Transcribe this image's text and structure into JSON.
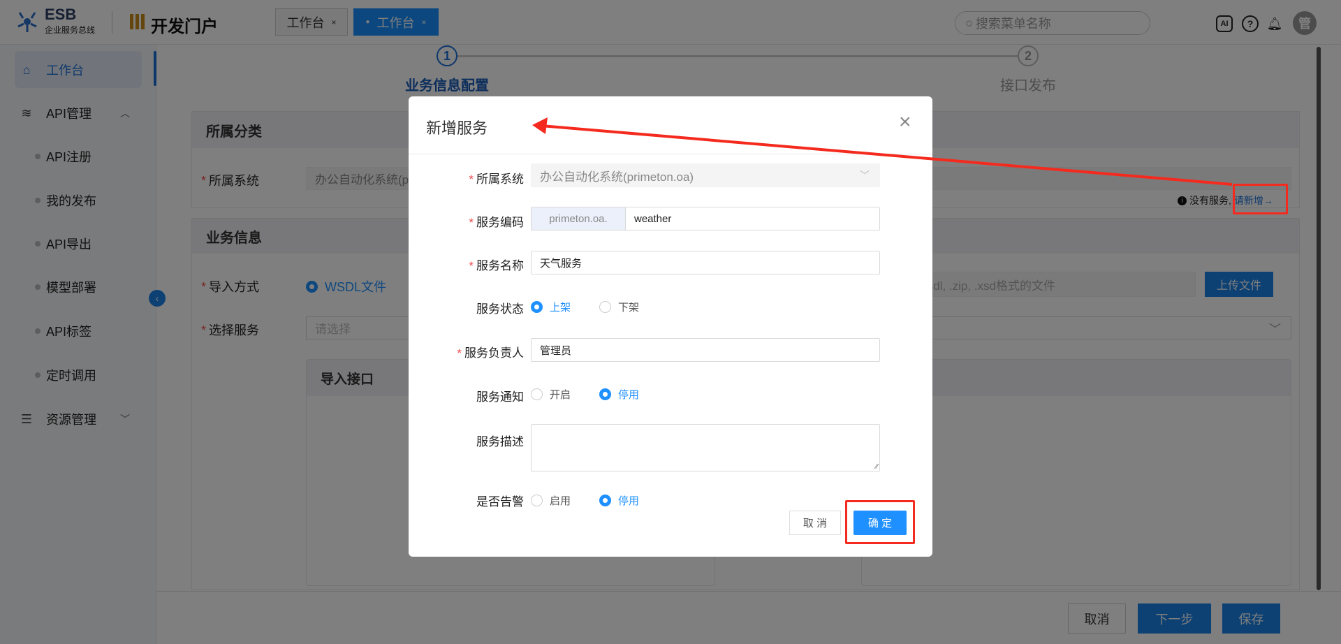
{
  "header": {
    "logo_title": "ESB",
    "logo_subtitle": "企业服务总线",
    "portal_title": "开发门户",
    "tabs": [
      {
        "label": "工作台",
        "close": "×"
      },
      {
        "label": "工作台",
        "close": "×",
        "active": true
      }
    ],
    "search_placeholder": "搜索菜单名称",
    "avatar_text": "管",
    "ai_icon_text": "AI"
  },
  "sidebar": {
    "items": [
      {
        "label": "工作台",
        "active": true
      },
      {
        "label": "API管理",
        "expanded": true
      },
      {
        "label": "API注册"
      },
      {
        "label": "我的发布"
      },
      {
        "label": "API导出"
      },
      {
        "label": "模型部署"
      },
      {
        "label": "API标签"
      },
      {
        "label": "定时调用"
      },
      {
        "label": "资源管理"
      }
    ]
  },
  "steps": [
    {
      "num": "1",
      "label": "业务信息配置",
      "active": true
    },
    {
      "num": "2",
      "label": "接口发布"
    }
  ],
  "category": {
    "title": "所属分类",
    "system_label": "所属系统",
    "system_value": "办公自动化系统(primeton.oa)",
    "hint": "没有服务,",
    "hint_link": "请新增→"
  },
  "business": {
    "title": "业务信息",
    "import_label": "导入方式",
    "import_option": "WSDL文件",
    "upload_placeholder": "请上传.wsdl, .zip, .xsd格式的文件",
    "upload_button": "上传文件",
    "select_label": "选择服务",
    "select_placeholder": "请选择",
    "left_panel_title": "导入接口",
    "right_panel_title": "已选接口"
  },
  "footer": {
    "cancel": "取消",
    "next": "下一步",
    "save": "保存"
  },
  "modal": {
    "title": "新增服务",
    "close": "×",
    "system": {
      "label": "所属系统",
      "value": "办公自动化系统(primeton.oa)"
    },
    "code": {
      "label": "服务编码",
      "prefix": "primeton.oa.",
      "value": "weather"
    },
    "name": {
      "label": "服务名称",
      "value": "天气服务"
    },
    "status": {
      "label": "服务状态",
      "options": [
        "上架",
        "下架"
      ],
      "selected": "上架"
    },
    "owner": {
      "label": "服务负责人",
      "value": "管理员"
    },
    "notify": {
      "label": "服务通知",
      "options": [
        "开启",
        "停用"
      ],
      "selected": "停用"
    },
    "desc": {
      "label": "服务描述",
      "value": ""
    },
    "alarm": {
      "label": "是否告警",
      "options": [
        "启用",
        "停用"
      ],
      "selected": "停用"
    },
    "cancel": "取 消",
    "confirm": "确 定"
  },
  "colors": {
    "primary": "#1890ff",
    "annotation": "#f52a1e"
  }
}
